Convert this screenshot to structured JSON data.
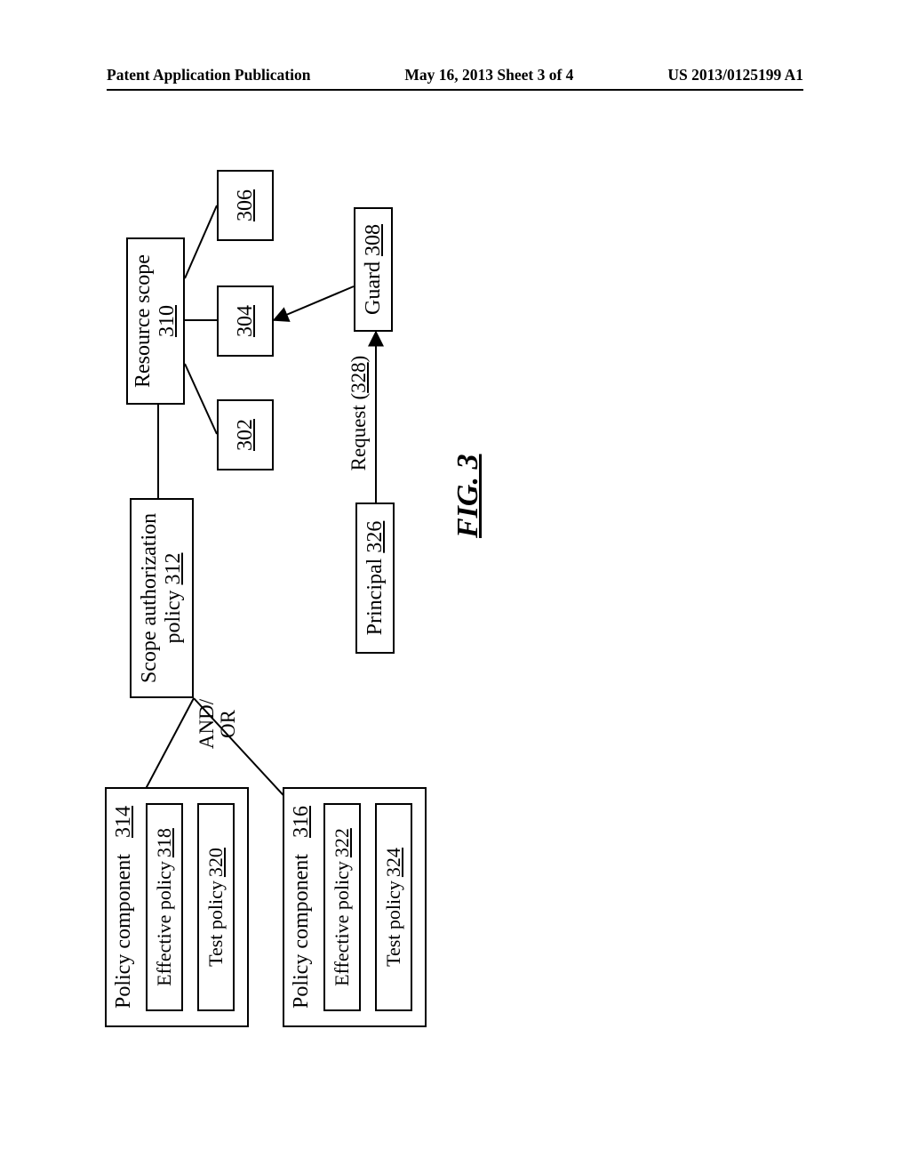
{
  "header": {
    "left": "Patent Application Publication",
    "center": "May 16, 2013  Sheet 3 of 4",
    "right": "US 2013/0125199 A1"
  },
  "fig_caption": "FIG. 3",
  "resource_scope": {
    "label": "Resource scope",
    "num": "310"
  },
  "res_a": "302",
  "res_b": "304",
  "res_c": "306",
  "guard": {
    "label": "Guard",
    "num": "308"
  },
  "principal": {
    "label": "Principal",
    "num": "326"
  },
  "request": {
    "label": "Request",
    "num": "328"
  },
  "scope_auth": {
    "label1": "Scope authorization",
    "label2": "policy",
    "num": "312"
  },
  "and_or": {
    "l1": "AND/",
    "l2": "OR"
  },
  "pc1": {
    "label": "Policy component",
    "num": "314"
  },
  "pc1_eff": {
    "label": "Effective policy",
    "num": "318"
  },
  "pc1_test": {
    "label": "Test policy",
    "num": "320"
  },
  "pc2": {
    "label": "Policy component",
    "num": "316"
  },
  "pc2_eff": {
    "label": "Effective policy",
    "num": "322"
  },
  "pc2_test": {
    "label": "Test policy",
    "num": "324"
  }
}
